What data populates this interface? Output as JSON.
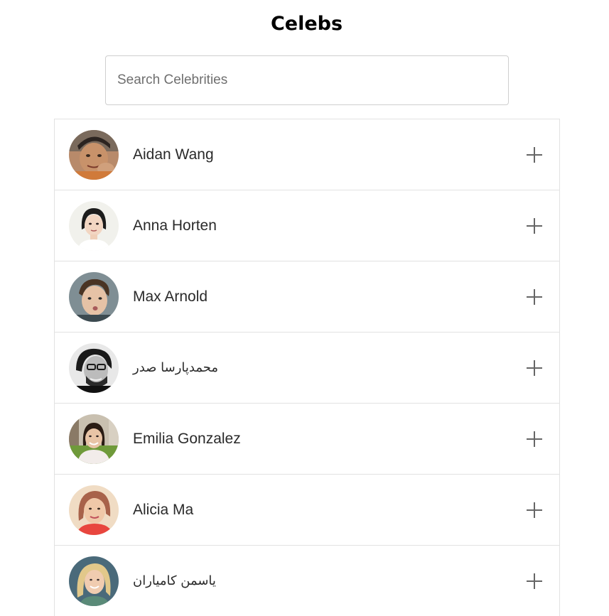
{
  "header": {
    "title": "Celebs"
  },
  "search": {
    "placeholder": "Search Celebrities",
    "value": ""
  },
  "celebs": [
    {
      "name": "Aidan Wang",
      "avatar_icon": "avatar-photo",
      "add_icon": "plus-icon"
    },
    {
      "name": "Anna Horten",
      "avatar_icon": "avatar-photo",
      "add_icon": "plus-icon"
    },
    {
      "name": "Max Arnold",
      "avatar_icon": "avatar-photo",
      "add_icon": "plus-icon"
    },
    {
      "name": "محمدپارسا صدر",
      "avatar_icon": "avatar-photo",
      "add_icon": "plus-icon"
    },
    {
      "name": "Emilia Gonzalez",
      "avatar_icon": "avatar-photo",
      "add_icon": "plus-icon"
    },
    {
      "name": "Alicia Ma",
      "avatar_icon": "avatar-photo",
      "add_icon": "plus-icon"
    },
    {
      "name": "یاسمن کامیاران",
      "avatar_icon": "avatar-photo",
      "add_icon": "plus-icon"
    }
  ],
  "colors": {
    "border": "#e2e2e2",
    "plus": "#666666",
    "title": "#000000"
  }
}
